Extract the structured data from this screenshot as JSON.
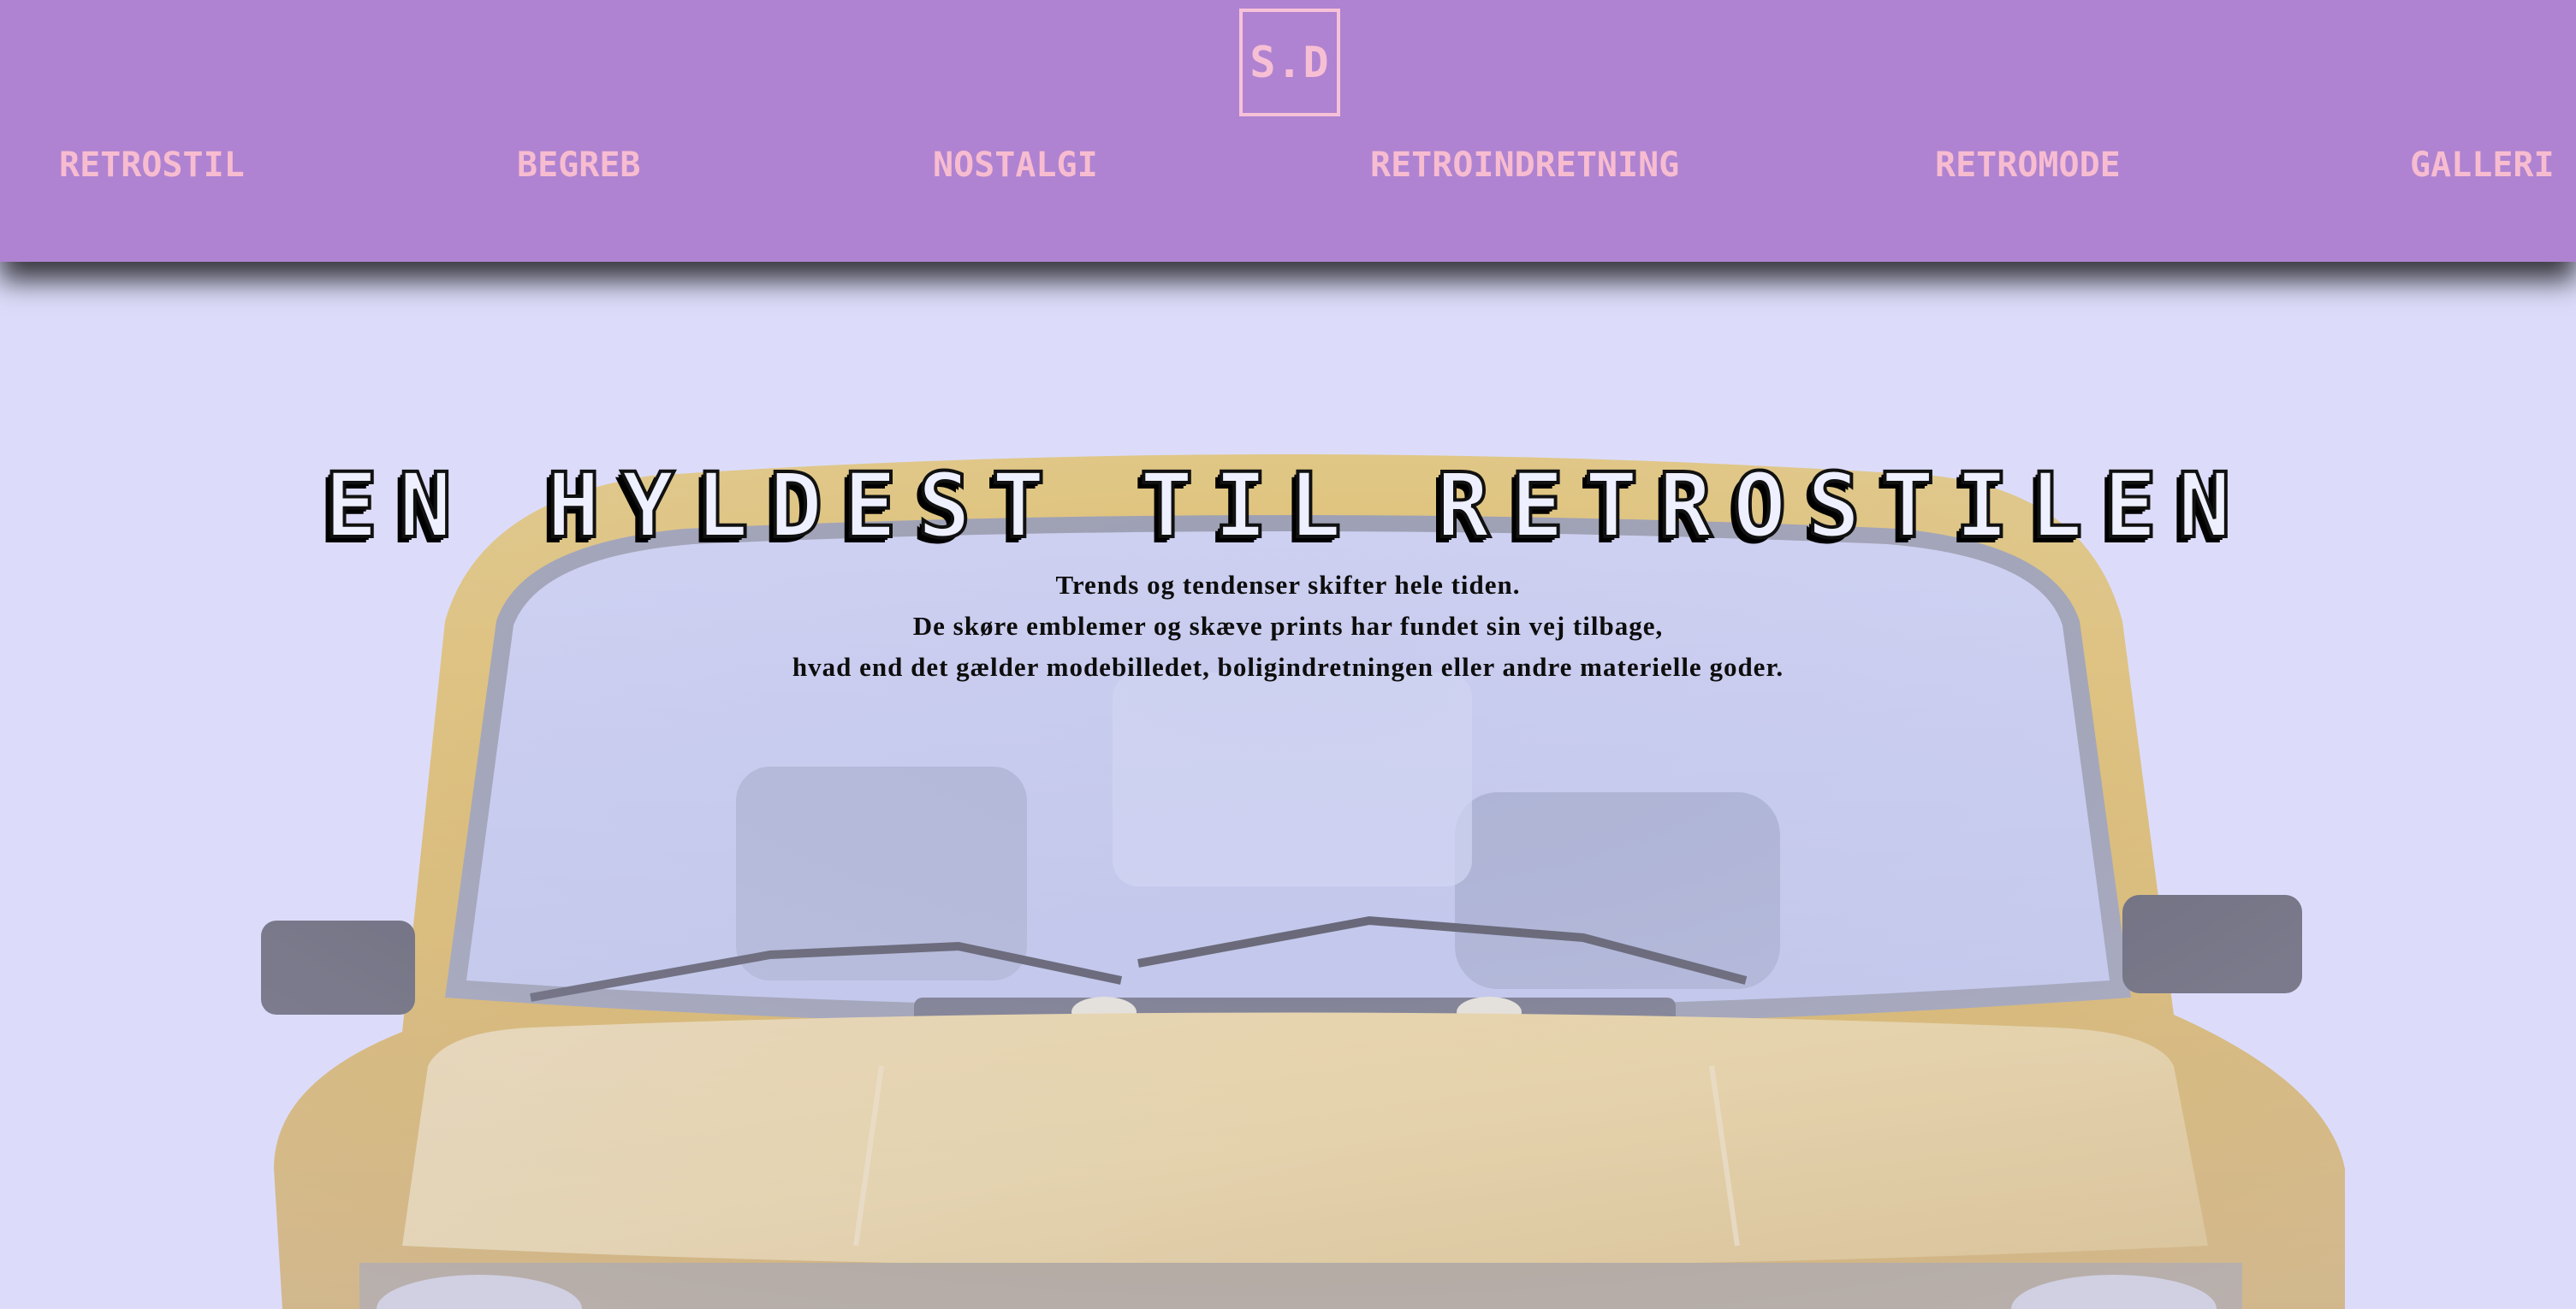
{
  "header": {
    "logo": "S.D",
    "nav": [
      {
        "label": "RETROSTIL"
      },
      {
        "label": "BEGREB"
      },
      {
        "label": "NOSTALGI"
      },
      {
        "label": "RETROINDRETNING"
      },
      {
        "label": "RETROMODE"
      },
      {
        "label": "GALLERI"
      }
    ]
  },
  "hero": {
    "title": "EN HYLDEST TIL RETROSTILEN",
    "intro": [
      "Trends og tendenser skifter hele tiden.",
      "De skøre emblemer og skæve prints har fundet sin vej tilbage,",
      "hvad end det gælder modebilledet, boligindretningen eller andre materielle goder."
    ],
    "image": "yellow-retro-car-photo"
  },
  "colors": {
    "header_bg": "#af83d1",
    "nav_text": "#f7bcd0",
    "page_bg": "#dcdcfb",
    "car_body": "#e0b548"
  }
}
